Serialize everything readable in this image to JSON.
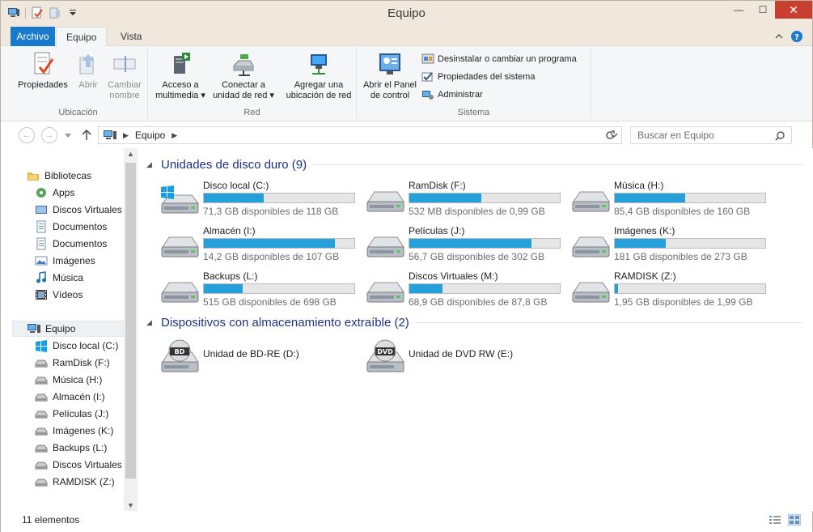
{
  "window": {
    "title": "Equipo"
  },
  "titlebar": {
    "minimize": "—",
    "maximize": "☐",
    "close": "✕"
  },
  "tabs": {
    "file": "Archivo",
    "computer": "Equipo",
    "view": "Vista"
  },
  "ribbon": {
    "groups": {
      "location": "Ubicación",
      "network": "Red",
      "system": "Sistema"
    },
    "properties": "Propiedades",
    "open": "Abrir",
    "rename_l1": "Cambiar",
    "rename_l2": "nombre",
    "media_l1": "Acceso a",
    "media_l2": "multimedia",
    "map_l1": "Conectar a",
    "map_l2": "unidad de red",
    "addnet_l1": "Agregar una",
    "addnet_l2": "ubicación de red",
    "cpanel_l1": "Abrir el Panel",
    "cpanel_l2": "de control",
    "uninstall": "Desinstalar o cambiar un programa",
    "sysprops": "Propiedades del sistema",
    "manage": "Administrar"
  },
  "address": {
    "path": "Equipo",
    "search_placeholder": "Buscar en Equipo"
  },
  "navpane": {
    "libraries": "Bibliotecas",
    "library_items": [
      "Apps",
      "Discos Virtuales",
      "Documentos",
      "Documentos",
      "Imágenes",
      "Música",
      "Vídeos"
    ],
    "computer": "Equipo",
    "computer_items": [
      "Disco local (C:)",
      "RamDisk (F:)",
      "Música (H:)",
      "Almacén (I:)",
      "Películas (J:)",
      "Imágenes (K:)",
      "Backups (L:)",
      "Discos Virtuales (",
      "RAMDISK (Z:)"
    ]
  },
  "content": {
    "hdd_header": "Unidades de disco duro (9)",
    "drives": [
      {
        "name": "Disco local (C:)",
        "info": "71,3 GB disponibles de 118 GB",
        "used": 0.4,
        "os": true
      },
      {
        "name": "RamDisk (F:)",
        "info": "532 MB disponibles de 0,99 GB",
        "used": 0.48
      },
      {
        "name": "Música (H:)",
        "info": "85,4 GB disponibles de 160 GB",
        "used": 0.47
      },
      {
        "name": "Almacén (I:)",
        "info": "14,2 GB disponibles de 107 GB",
        "used": 0.87
      },
      {
        "name": "Películas (J:)",
        "info": "56,7 GB disponibles de 302 GB",
        "used": 0.81
      },
      {
        "name": "Imágenes (K:)",
        "info": "181 GB disponibles de 273 GB",
        "used": 0.34
      },
      {
        "name": "Backups (L:)",
        "info": "515 GB disponibles de 698 GB",
        "used": 0.26
      },
      {
        "name": "Discos Virtuales (M:)",
        "info": "68,9 GB disponibles de 87,8 GB",
        "used": 0.22
      },
      {
        "name": "RAMDISK (Z:)",
        "info": "1,95 GB disponibles de 1,99 GB",
        "used": 0.02
      }
    ],
    "removable_header": "Dispositivos con almacenamiento extraíble (2)",
    "removables": [
      {
        "name": "Unidad de BD-RE (D:)",
        "badge": "BD"
      },
      {
        "name": "Unidad de DVD RW (E:)",
        "badge": "DVD"
      }
    ]
  },
  "status": {
    "count": "11 elementos"
  },
  "colors": {
    "accent": "#1979ca",
    "bar_fill": "#26a0da",
    "header_text": "#1e3287",
    "titlebar": "#f0e8dc"
  }
}
